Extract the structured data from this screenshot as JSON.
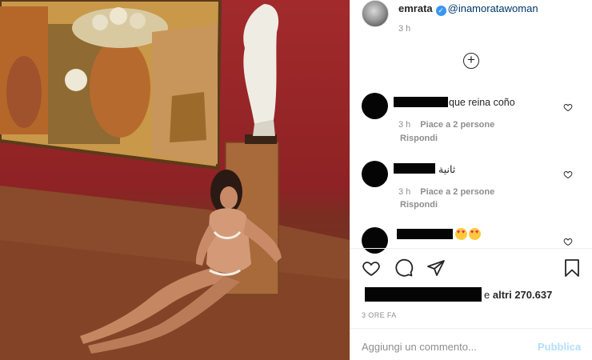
{
  "post": {
    "author": "emrata",
    "verified": true,
    "mention": "@inamoratawoman",
    "time": "3 h"
  },
  "comments": [
    {
      "text": "que reina coño",
      "time": "3 h",
      "likes": "Piace a 2 persone",
      "reply": "Rispondi"
    },
    {
      "text": "ثانية",
      "time": "3 h",
      "likes": "Piace a 2 persone",
      "reply": "Rispondi"
    },
    {
      "text": "",
      "emoji": [
        "heart-eyes-emoji",
        "heart-eyes-emoji"
      ]
    }
  ],
  "actions": {
    "like": "heart-icon",
    "comment": "speech-bubble-icon",
    "share": "paper-plane-icon",
    "save": "bookmark-icon"
  },
  "likes_summary": {
    "prefix": "e",
    "count": "altri 270.637"
  },
  "posted_ago": "3 ORE FA",
  "comment_box": {
    "placeholder": "Aggiungi un commento...",
    "publish_label": "Pubblica"
  },
  "colors": {
    "verified": "#3897f0",
    "publish_disabled": "#b2dffc",
    "wall_red": "#9b2729",
    "secondary_text": "#8e8e8e"
  }
}
